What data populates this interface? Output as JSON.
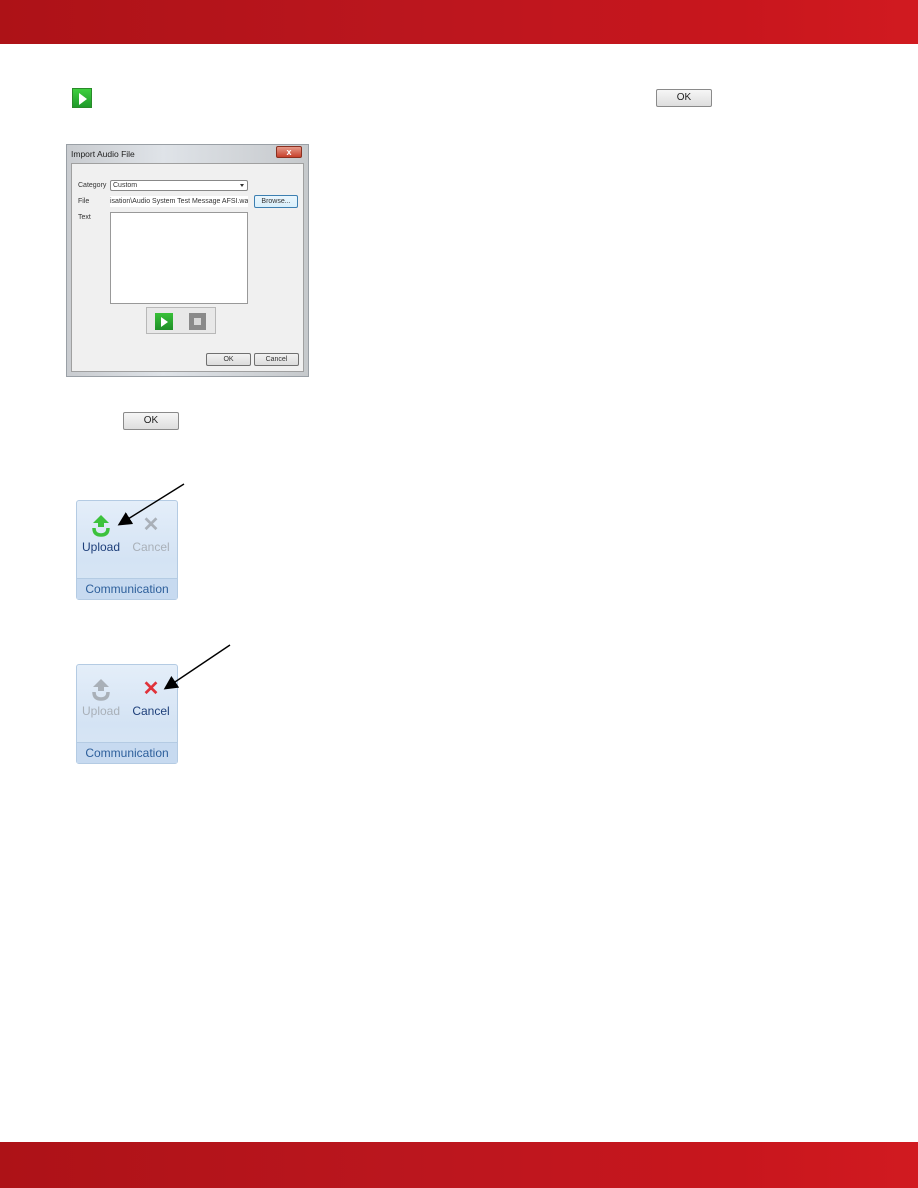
{
  "page": {
    "header_color": "#c1161d",
    "footer_color": "#c1161d"
  },
  "inline": {
    "play_icon": "play-icon",
    "ok_label": "OK"
  },
  "dialog": {
    "title": "Import Audio File",
    "close_label": "x",
    "category_label": "Category",
    "category_value": "Custom",
    "file_label": "File",
    "file_value": "isation\\Audio System Test Message AFSI.wav",
    "browse_label": "Browse...",
    "text_label": "Text",
    "text_value": "",
    "play_icon": "play-icon",
    "stop_icon": "stop-icon",
    "ok_label": "OK",
    "cancel_label": "Cancel"
  },
  "ok_below": {
    "label": "OK"
  },
  "ribbon_upload_enabled": {
    "upload_label": "Upload",
    "cancel_label": "Cancel",
    "group_label": "Communication",
    "upload_enabled": true,
    "cancel_enabled": false
  },
  "ribbon_cancel_enabled": {
    "upload_label": "Upload",
    "cancel_label": "Cancel",
    "group_label": "Communication",
    "upload_enabled": false,
    "cancel_enabled": true
  }
}
